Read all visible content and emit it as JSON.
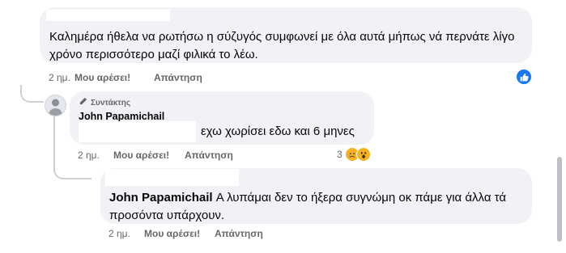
{
  "comments": [
    {
      "text": "Καλημέρα ήθελα να ρωτήσω η σύζυγός συμφωνεί με όλα αυτά μήπως νά περνάτε λίγο χρόνο περισσότερο μαζί φιλικά το λέω.",
      "time": "2 ημ.",
      "like": "Μου αρέσει!",
      "reply": "Απάντηση",
      "reaction_icon": "thumbs-up-icon"
    },
    {
      "author_badge": "Συντάκτης",
      "author": "John Papamichail",
      "text": "εχω χωρίσει εδω και 6 μηνες",
      "time": "2 ημ.",
      "like": "Μου αρέσει!",
      "reply": "Απάντηση",
      "reaction_count": "3",
      "reaction_icons": [
        "sad-emoji-icon",
        "wow-emoji-icon"
      ]
    },
    {
      "author": "John Papamichail",
      "text": "Α λυπάμαι δεν το ήξερα συγνώμη οκ πάμε για άλλα τά προσόντα υπάρχουν.",
      "time": "2 ημ.",
      "like": "Μου αρέσει!",
      "reply": "Απάντηση"
    }
  ],
  "colors": {
    "bubble": "#f0f2f5",
    "secondary_text": "#65676b",
    "accent": "#1877f2",
    "emoji": "#f7b125"
  }
}
